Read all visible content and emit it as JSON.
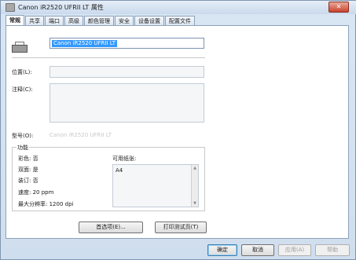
{
  "window": {
    "title": "Canon iR2520 UFRII LT 属性",
    "close_glyph": "✕"
  },
  "tabs": [
    {
      "label": "常规"
    },
    {
      "label": "共享"
    },
    {
      "label": "端口"
    },
    {
      "label": "高级"
    },
    {
      "label": "颜色管理"
    },
    {
      "label": "安全"
    },
    {
      "label": "设备设置"
    },
    {
      "label": "配置文件"
    }
  ],
  "general": {
    "printer_name": "Canon iR2520 UFRII LT",
    "location_label": "位置(L):",
    "location_value": "",
    "comment_label": "注释(C):",
    "comment_value": "",
    "model_label": "型号(O):",
    "model_value": "Canon iR2520 UFRII LT"
  },
  "features": {
    "group_label": "功能",
    "color": "彩色: 否",
    "duplex": "双面: 是",
    "staple": "装订: 否",
    "speed": "速度: 20 ppm",
    "max_resolution": "最大分辨率: 1200 dpi",
    "paper_label": "可用纸张:",
    "paper_items": [
      "A4"
    ]
  },
  "buttons": {
    "preferences": "首选项(E)...",
    "print_test": "打印测试页(T)",
    "ok": "确定",
    "cancel": "取消",
    "apply": "应用(A)",
    "help": "帮助"
  },
  "icons": {
    "title": "printer-icon",
    "printer": "printer-icon",
    "close": "close-icon"
  }
}
